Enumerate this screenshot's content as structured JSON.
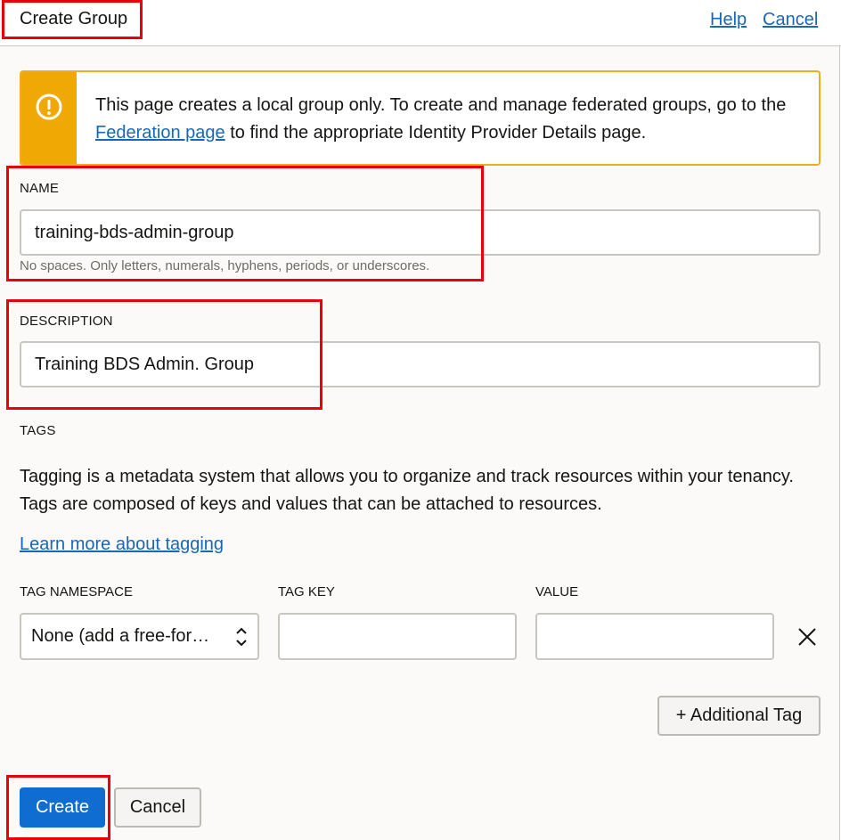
{
  "header": {
    "title": "Create Group",
    "help_link": "Help",
    "cancel_link": "Cancel"
  },
  "banner": {
    "text_before": "This page creates a local group only. To create and manage federated groups, go to the ",
    "link": "Federation page",
    "text_after": " to find the appropriate Identity Provider Details page.",
    "accent_color": "#f0a805",
    "icon": "warning-circle-icon"
  },
  "name_field": {
    "label": "NAME",
    "value": "training-bds-admin-group",
    "help": "No spaces. Only letters, numerals, hyphens, periods, or underscores."
  },
  "description_field": {
    "label": "DESCRIPTION",
    "value": "Training BDS Admin. Group"
  },
  "tags": {
    "heading": "TAGS",
    "description": "Tagging is a metadata system that allows you to organize and track resources within your tenancy. Tags are composed of keys and values that can be attached to resources.",
    "learn_more": "Learn more about tagging",
    "columns": {
      "namespace": "TAG NAMESPACE",
      "key": "TAG KEY",
      "value": "VALUE"
    },
    "row": {
      "namespace_selected": "None (add a free-for…",
      "key": "",
      "value": ""
    },
    "add_button": "+ Additional Tag"
  },
  "footer": {
    "create_button": "Create",
    "cancel_button": "Cancel"
  },
  "colors": {
    "primary": "#0f6cd1",
    "link": "#1868b7",
    "highlight": "#e8000b"
  }
}
